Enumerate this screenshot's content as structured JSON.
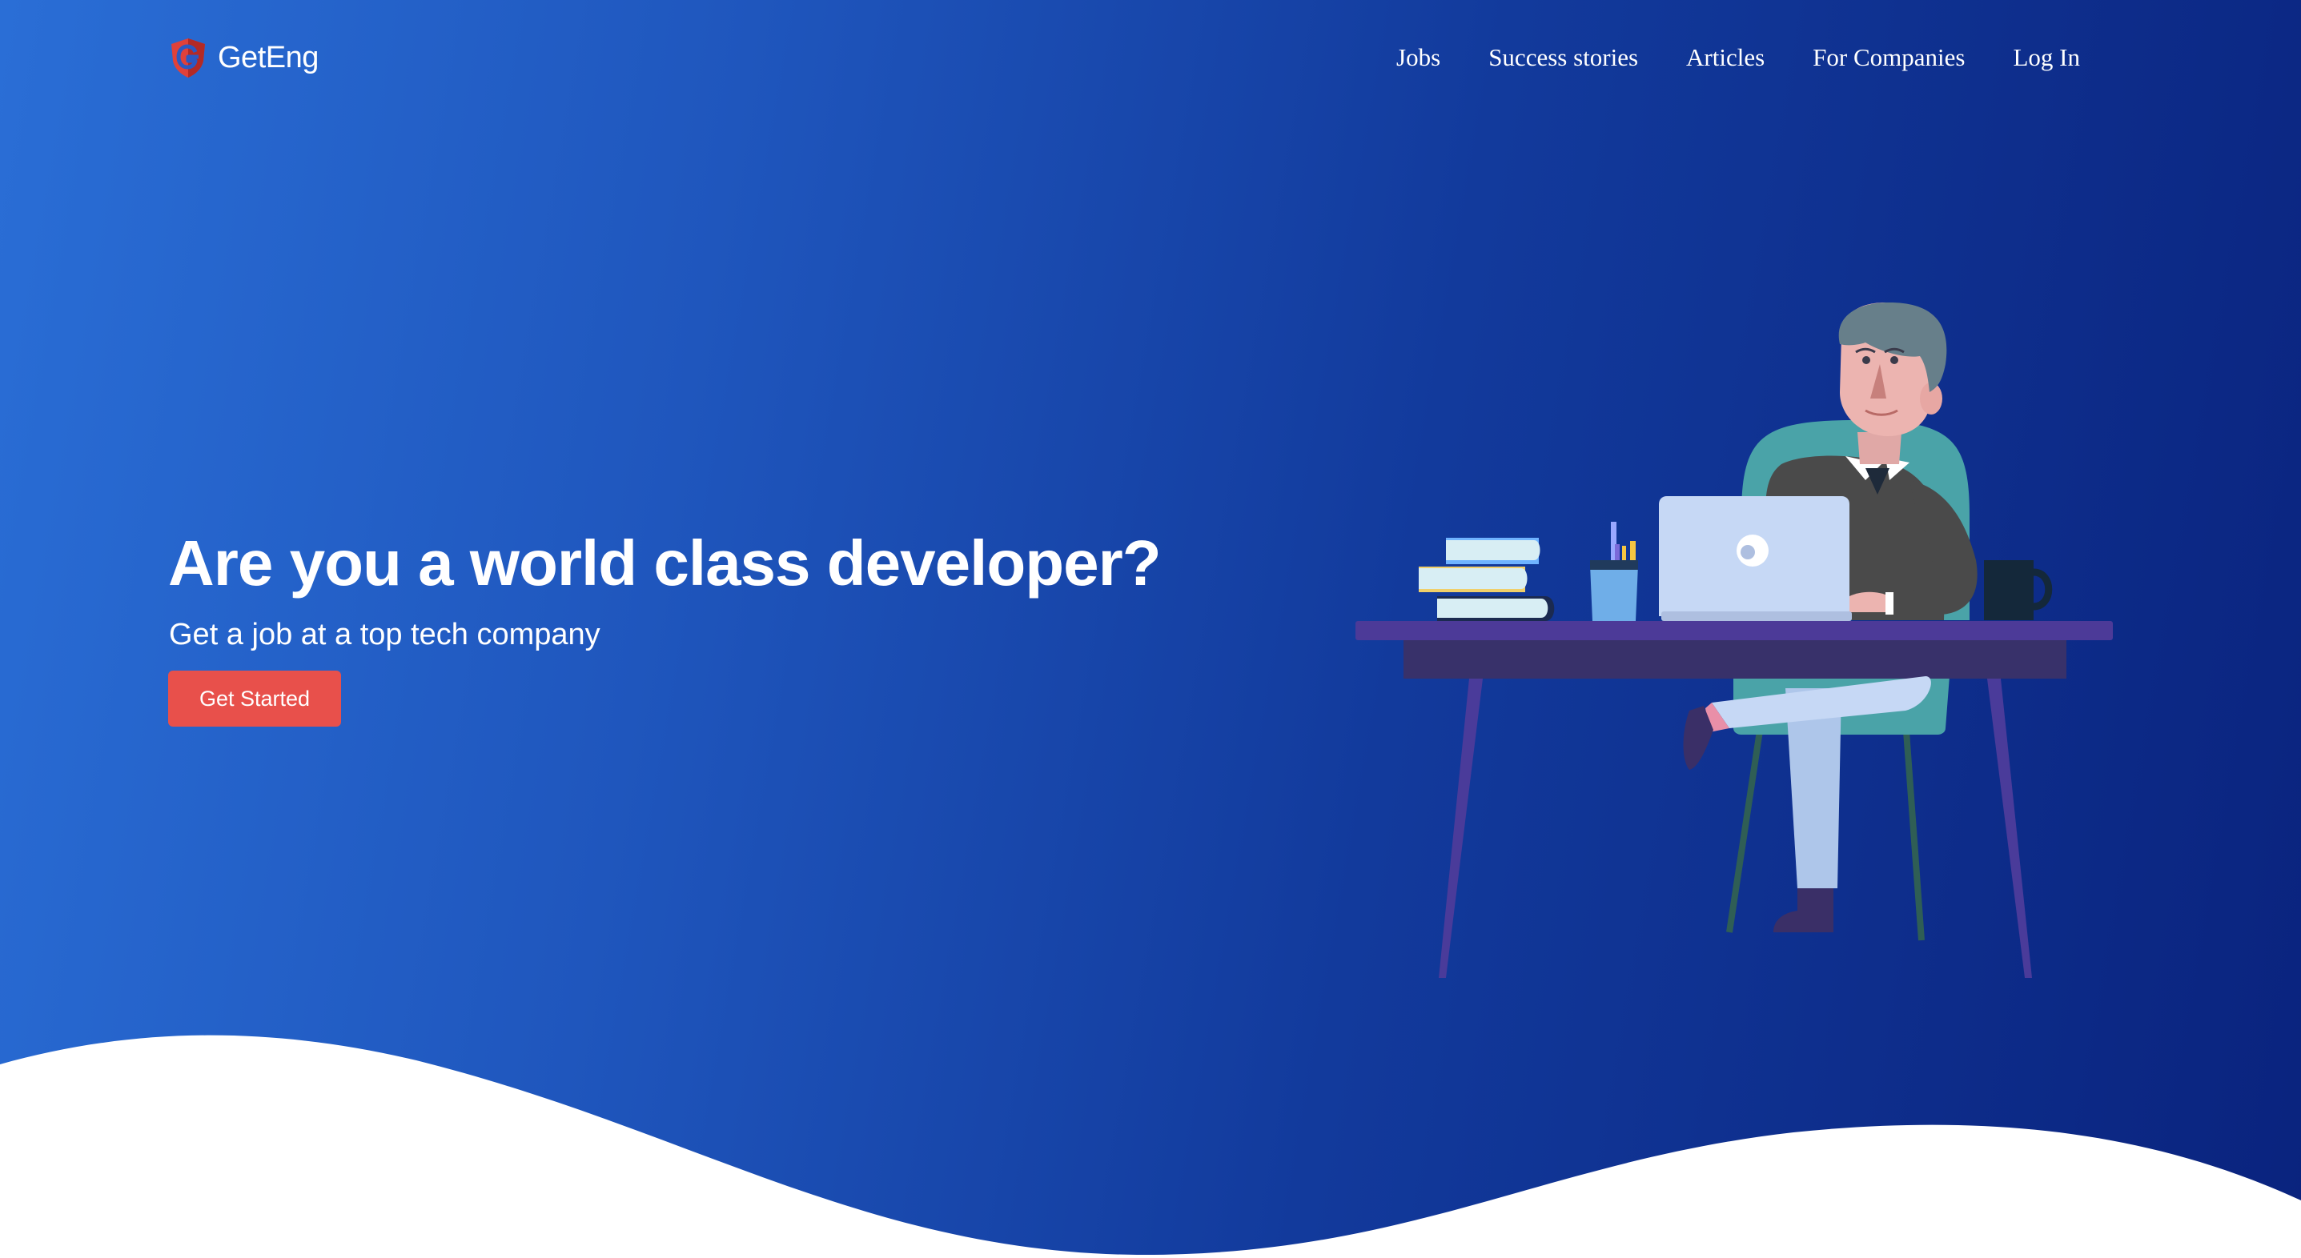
{
  "brand": {
    "name": "GetEng",
    "logo_icon": "shield-g-logo",
    "logo_color": "#e0413a"
  },
  "nav": {
    "items": [
      {
        "label": "Jobs"
      },
      {
        "label": "Success stories"
      },
      {
        "label": "Articles"
      },
      {
        "label": "For Companies"
      },
      {
        "label": "Log In"
      }
    ]
  },
  "hero": {
    "headline": "Are you a world class developer?",
    "subheadline": "Get a job at a top tech company",
    "cta_label": "Get Started",
    "cta_color": "#e8504b",
    "gradient_start": "#2a6ed6",
    "gradient_end": "#0a237e",
    "illustration": "developer-at-desk-illustration"
  }
}
